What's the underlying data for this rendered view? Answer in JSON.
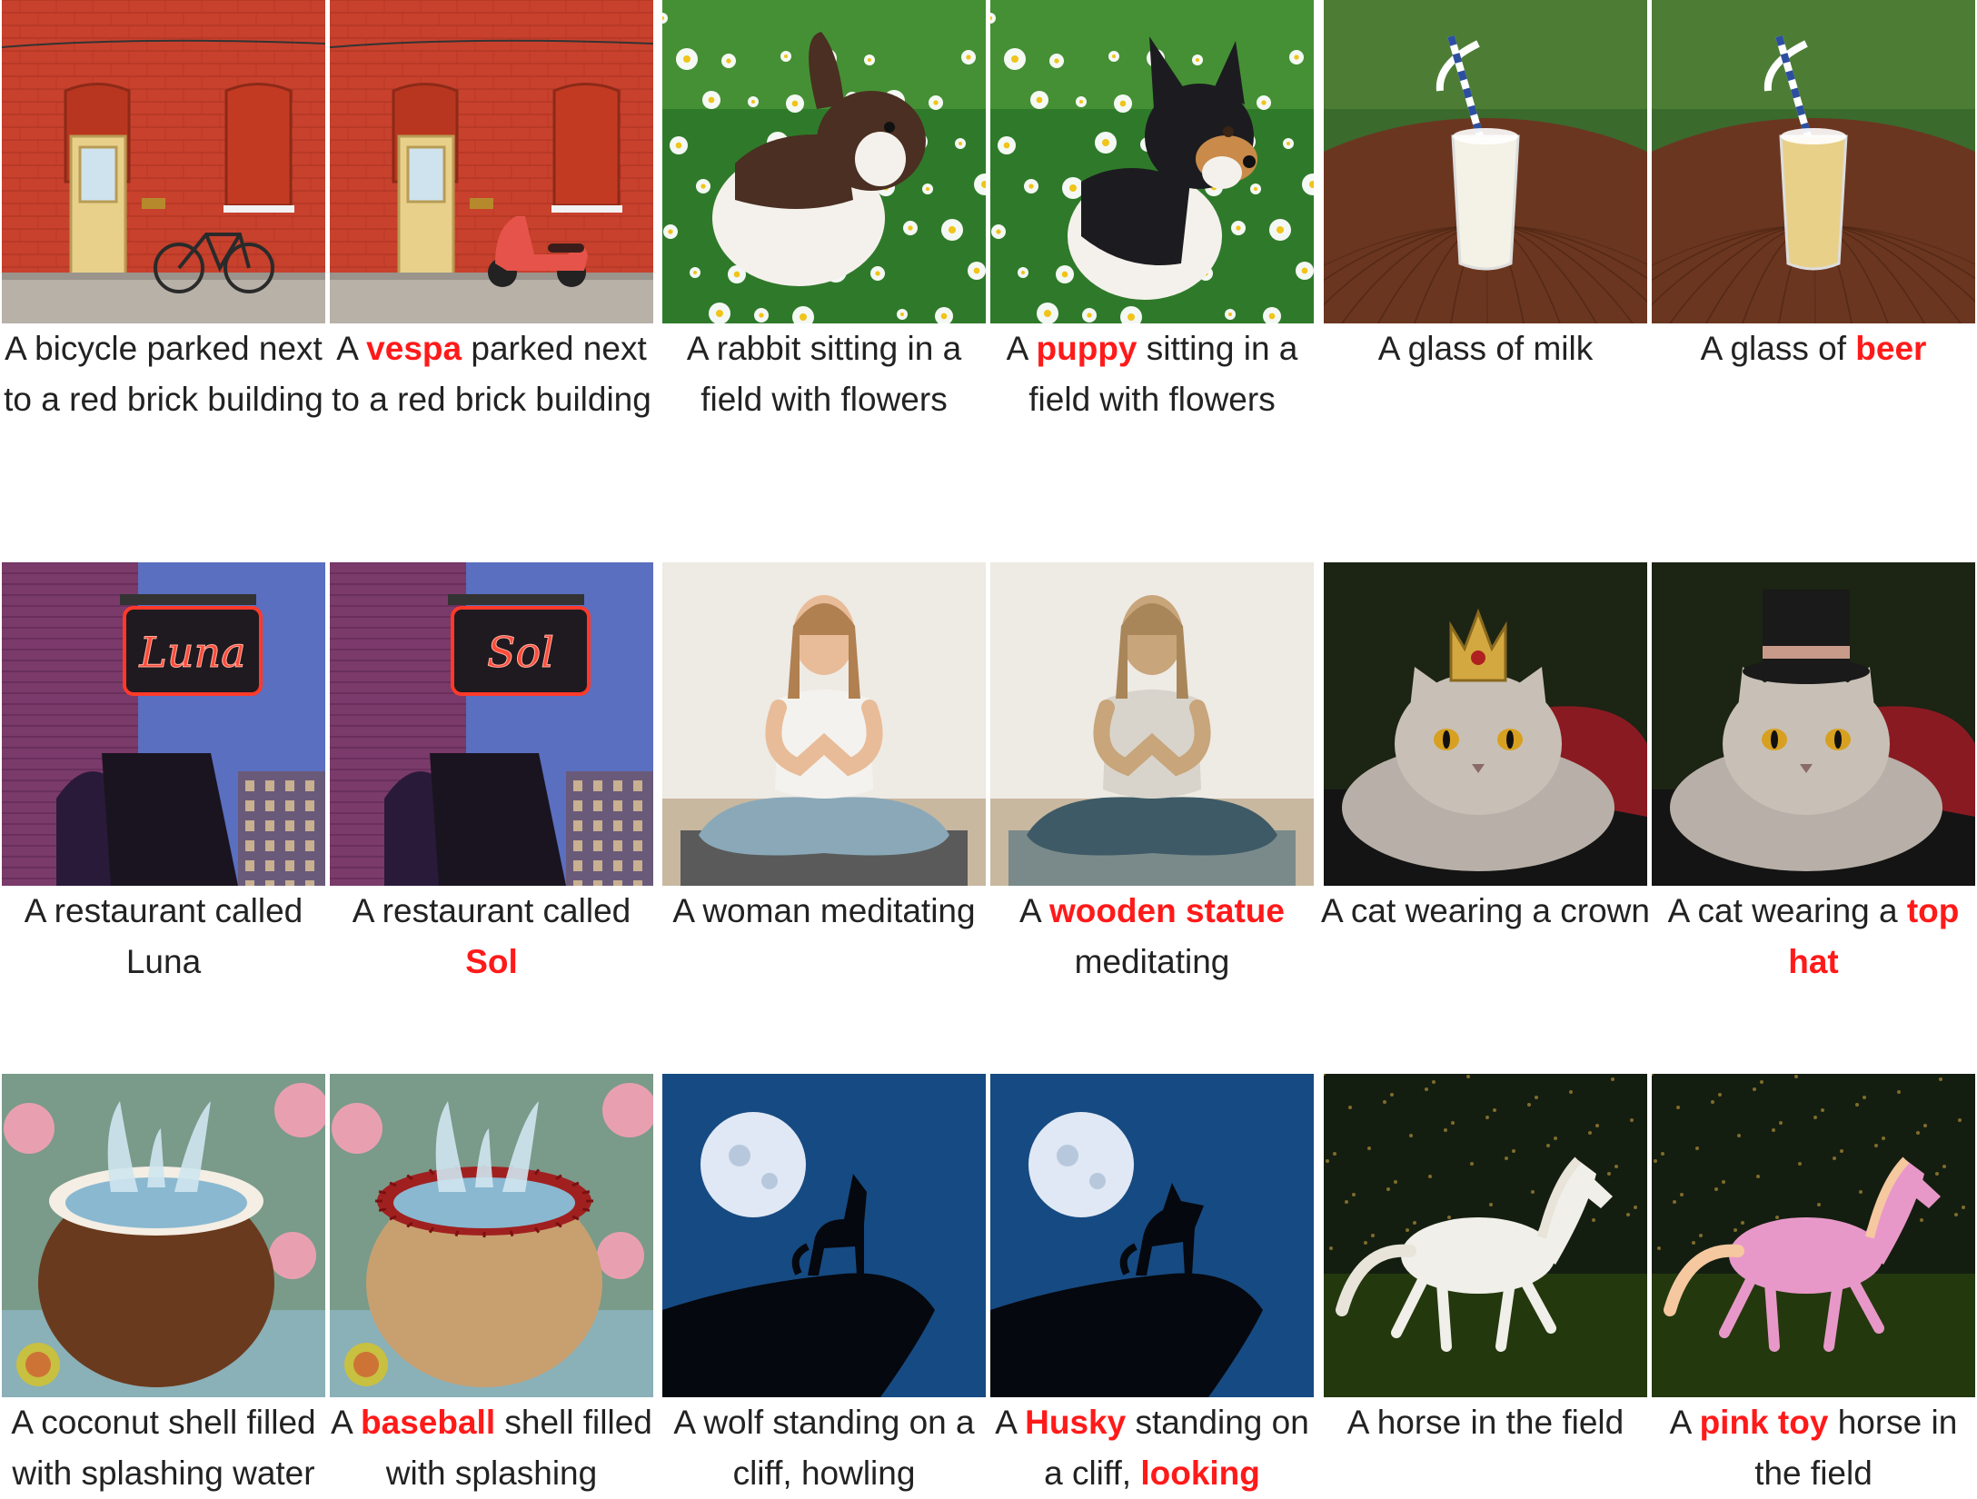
{
  "highlight_color": "#ff1a1a",
  "rows": [
    {
      "cells": [
        {
          "scene": "brick-bicycle",
          "caption": [
            {
              "text": "A bicycle parked next to a red brick building",
              "hl": false
            }
          ]
        },
        {
          "scene": "brick-vespa",
          "caption": [
            {
              "text": "A ",
              "hl": false
            },
            {
              "text": "vespa",
              "hl": true
            },
            {
              "text": " parked next to a red brick building",
              "hl": false
            }
          ]
        },
        {
          "scene": "rabbit-field",
          "caption": [
            {
              "text": "A rabbit sitting in a field with flowers",
              "hl": false
            }
          ]
        },
        {
          "scene": "puppy-field",
          "caption": [
            {
              "text": "A ",
              "hl": false
            },
            {
              "text": "puppy",
              "hl": true
            },
            {
              "text": " sitting in a field with flowers",
              "hl": false
            }
          ]
        },
        {
          "scene": "glass-milk",
          "caption": [
            {
              "text": "A glass of milk",
              "hl": false
            }
          ]
        },
        {
          "scene": "glass-beer",
          "caption": [
            {
              "text": "A glass of ",
              "hl": false
            },
            {
              "text": "beer",
              "hl": true
            }
          ]
        }
      ]
    },
    {
      "cells": [
        {
          "scene": "neon-sign",
          "sign_text": "Luna",
          "caption": [
            {
              "text": "A restaurant called Luna",
              "hl": false
            }
          ]
        },
        {
          "scene": "neon-sign",
          "sign_text": "Sol",
          "caption": [
            {
              "text": "A restaurant called ",
              "hl": false
            },
            {
              "text": "Sol",
              "hl": true
            }
          ]
        },
        {
          "scene": "woman-meditating",
          "caption": [
            {
              "text": "A woman meditating",
              "hl": false
            }
          ]
        },
        {
          "scene": "statue-meditating",
          "caption": [
            {
              "text": "A ",
              "hl": false
            },
            {
              "text": "wooden statue",
              "hl": true
            },
            {
              "text": " meditating",
              "hl": false
            }
          ]
        },
        {
          "scene": "cat-crown",
          "caption": [
            {
              "text": "A cat wearing a crown",
              "hl": false
            }
          ]
        },
        {
          "scene": "cat-tophat",
          "caption": [
            {
              "text": "A cat wearing a ",
              "hl": false
            },
            {
              "text": "top hat",
              "hl": true
            }
          ]
        }
      ]
    },
    {
      "cells": [
        {
          "scene": "coconut-splash",
          "caption": [
            {
              "text": "A coconut shell filled with splashing water",
              "hl": false
            }
          ]
        },
        {
          "scene": "baseball-splash",
          "caption": [
            {
              "text": "A ",
              "hl": false
            },
            {
              "text": "baseball",
              "hl": true
            },
            {
              "text": " shell filled with splashing",
              "hl": false
            }
          ]
        },
        {
          "scene": "wolf-moon",
          "caption": [
            {
              "text": "A wolf standing on a cliff, howling",
              "hl": false
            }
          ]
        },
        {
          "scene": "husky-moon",
          "caption": [
            {
              "text": "A ",
              "hl": false
            },
            {
              "text": "Husky",
              "hl": true
            },
            {
              "text": " standing on a cliff, ",
              "hl": false
            },
            {
              "text": "looking",
              "hl": true
            }
          ]
        },
        {
          "scene": "white-horse",
          "caption": [
            {
              "text": "A horse in the field",
              "hl": false
            }
          ]
        },
        {
          "scene": "pink-horse",
          "caption": [
            {
              "text": "A ",
              "hl": false
            },
            {
              "text": "pink toy",
              "hl": true
            },
            {
              "text": " horse in the field",
              "hl": false
            }
          ]
        }
      ]
    }
  ]
}
